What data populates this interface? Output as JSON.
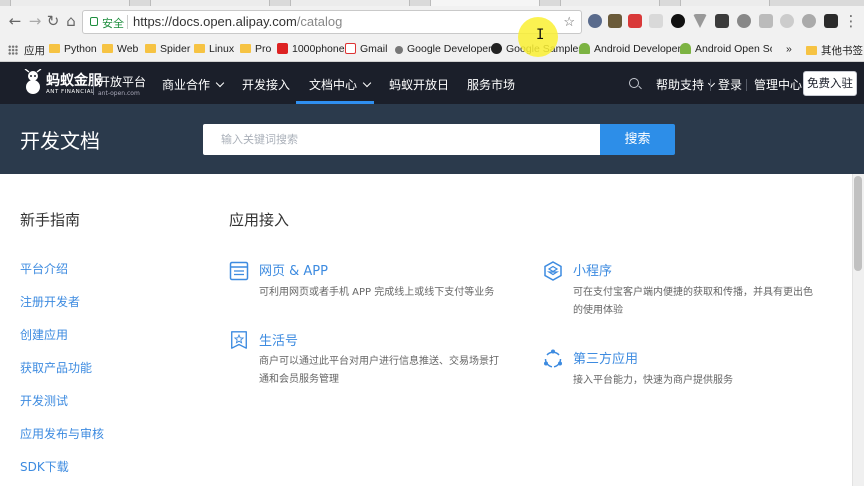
{
  "browser": {
    "secure_label": "安全",
    "url_host": "https://docs.open.alipay.com",
    "url_path": "/catalog",
    "bookmarks": [
      "应用",
      "Python",
      "Web",
      "Spider",
      "Linux",
      "Pro",
      "1000phone",
      "Gmail",
      "Google Developers",
      "Google Samples",
      "Android Developer",
      "Android Open Sou",
      "»",
      "其他书签"
    ]
  },
  "header": {
    "logo_cn": "蚂蚁金服",
    "logo_en": "ANT FINANCIAL",
    "logo_sub": "开放平台",
    "logo_sub_en": "ant-open.com",
    "nav": [
      "商业合作",
      "开发接入",
      "文档中心",
      "蚂蚁开放日",
      "服务市场"
    ],
    "help": "帮助支持",
    "login": "登录",
    "console": "管理中心",
    "signup": "免费入驻"
  },
  "banner": {
    "title": "开发文档",
    "search_placeholder": "输入关键词搜索",
    "search_button": "搜索"
  },
  "sidebar": {
    "title": "新手指南",
    "items": [
      "平台介绍",
      "注册开发者",
      "创建应用",
      "获取产品功能",
      "开发测试",
      "应用发布与审核",
      "SDK下载"
    ]
  },
  "main": {
    "section_title": "应用接入",
    "cards": [
      {
        "title": "网页 & APP",
        "desc": "可利用网页或者手机 APP 完成线上或线下支付等业务",
        "icon": "web-app-icon"
      },
      {
        "title": "小程序",
        "desc": "可在支付宝客户端内便捷的获取和传播，并具有更出色的使用体验",
        "icon": "mini-program-icon"
      },
      {
        "title": "生活号",
        "desc": "商户可以通过此平台对用户进行信息推送、交易场景打通和会员服务管理",
        "icon": "life-account-icon"
      },
      {
        "title": "第三方应用",
        "desc": "接入平台能力，快速为商户提供服务",
        "icon": "third-party-icon"
      }
    ]
  },
  "colors": {
    "header_bg": "#1b1f2a",
    "banner_bg": "#2b3a4c",
    "accent": "#2d8ee8",
    "link": "#3d8be0"
  }
}
